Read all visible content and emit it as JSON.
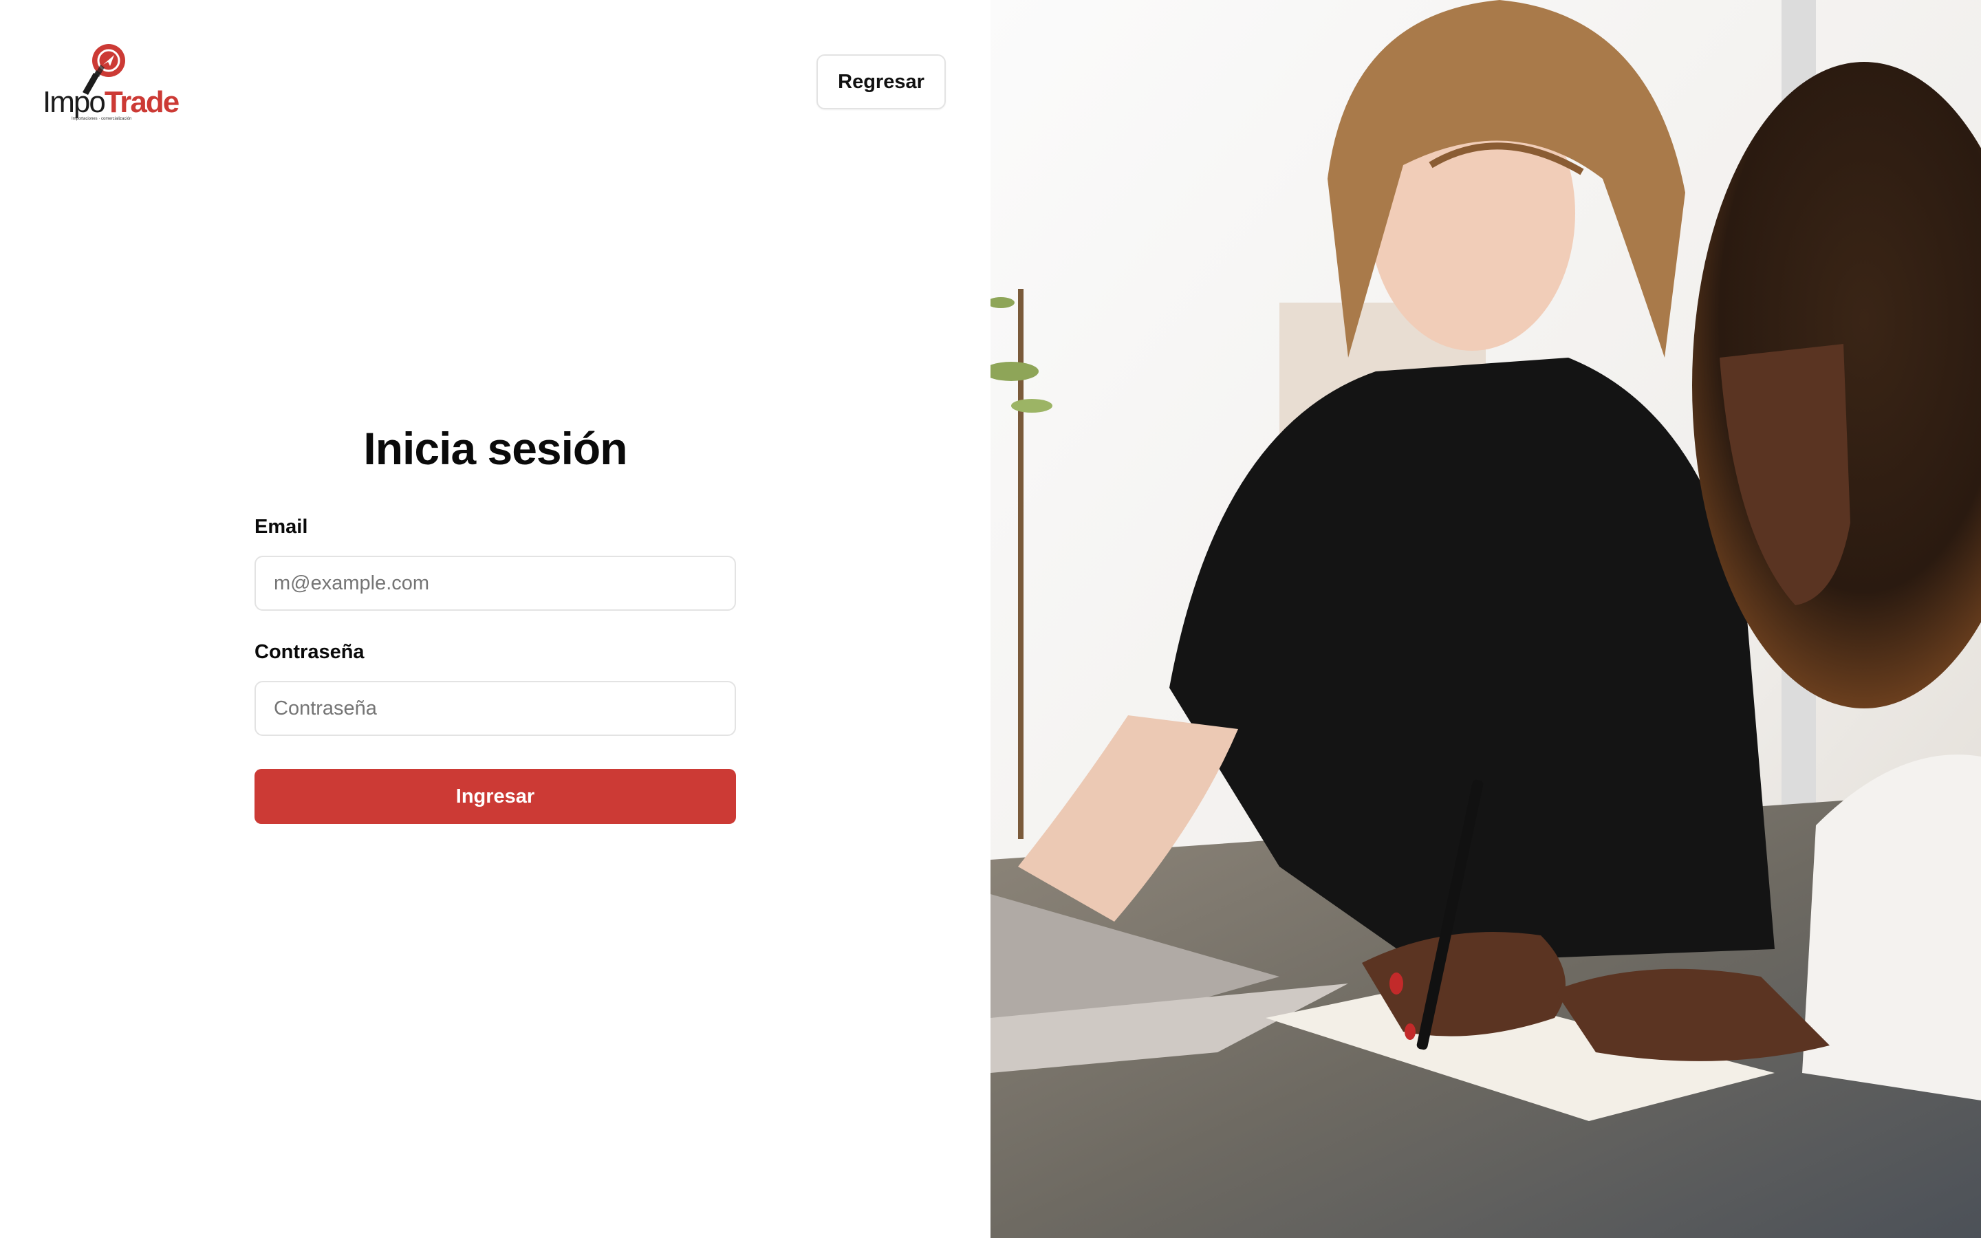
{
  "brand": {
    "name_part1": "Impo",
    "name_part2": "Trade",
    "tagline": "Importaciones · comercialización",
    "accent_color": "#cc3a35"
  },
  "header": {
    "back_label": "Regresar"
  },
  "login": {
    "title": "Inicia sesión",
    "email_label": "Email",
    "email_placeholder": "m@example.com",
    "password_label": "Contraseña",
    "password_placeholder": "Contraseña",
    "submit_label": "Ingresar"
  },
  "hero": {
    "icon": "photo-two-people-working-laptop"
  }
}
